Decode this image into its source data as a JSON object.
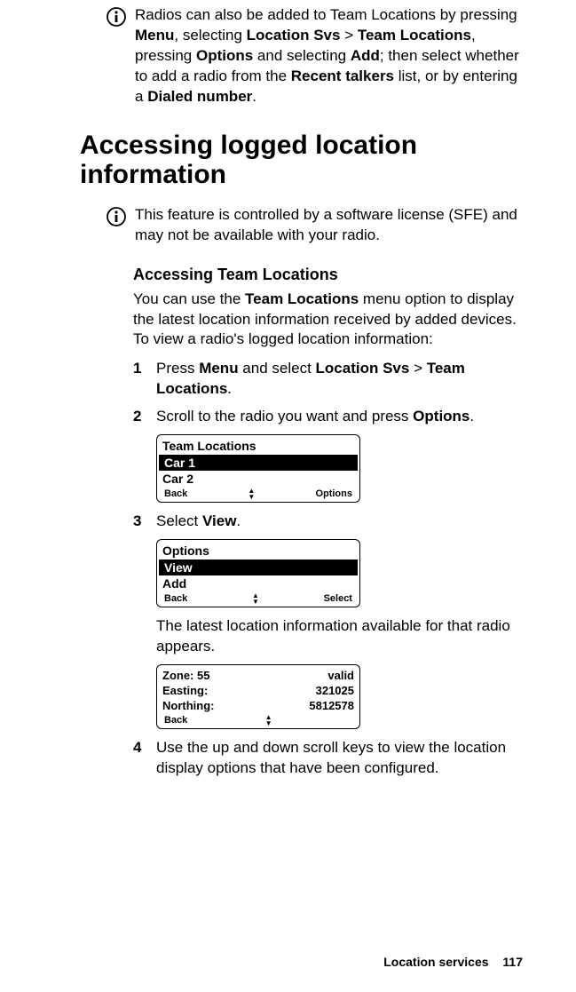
{
  "info1": {
    "p1": "Radios can also be added to Team Locations by pressing ",
    "b1": "Menu",
    "p2": ", selecting ",
    "b2": "Location Svs",
    "p3": " > ",
    "b3": "Team Locations",
    "p4": ", pressing ",
    "b4": "Options",
    "p5": " and selecting ",
    "b5": "Add",
    "p6": "; then select whether to add a radio from the ",
    "b6": "Recent talkers",
    "p7": " list, or by entering a ",
    "b7": "Dialed number",
    "p8": "."
  },
  "heading": "Accessing logged location information",
  "info2": "This feature is controlled by a software license (SFE) and may not be available with your radio.",
  "subheading": "Accessing Team Locations",
  "intro": {
    "p1": "You can use the ",
    "b1": "Team Locations",
    "p2": " menu option to display the latest location information received by added devices. To view a radio's logged location information:"
  },
  "step1": {
    "num": "1",
    "p1": "Press ",
    "b1": "Menu",
    "p2": " and select ",
    "b2": "Location Svs",
    "p3": " > ",
    "b3": "Team Locations",
    "p4": "."
  },
  "step2": {
    "num": "2",
    "p1": "Scroll to the radio you want and press ",
    "b1": "Options",
    "p2": "."
  },
  "screen1": {
    "title": "Team Locations",
    "row1": "Car 1",
    "row2": "Car 2",
    "sk_left": "Back",
    "sk_right": "Options"
  },
  "step3": {
    "num": "3",
    "p1": "Select ",
    "b1": "View",
    "p2": "."
  },
  "screen2": {
    "title": "Options",
    "row1": "View",
    "row2": "Add",
    "sk_left": "Back",
    "sk_right": "Select"
  },
  "info_after_screen2": "The latest location information available for that radio appears.",
  "screen3": {
    "r1k": "Zone: 55",
    "r1v": "valid",
    "r2k": "Easting:",
    "r2v": "321025",
    "r3k": "Northing:",
    "r3v": "5812578",
    "sk_left": "Back"
  },
  "step4": {
    "num": "4",
    "text": "Use the up and down scroll keys to view the location display options that have been configured."
  },
  "footer": {
    "label": "Location services",
    "page": "117"
  }
}
